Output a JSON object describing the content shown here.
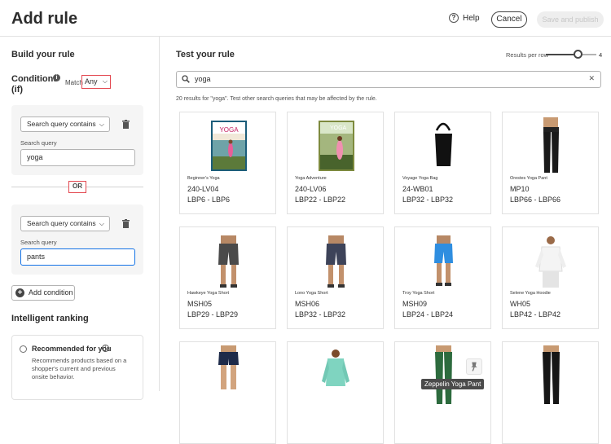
{
  "header": {
    "title": "Add rule",
    "help_label": "Help",
    "cancel_label": "Cancel",
    "save_label": "Save and publish"
  },
  "left": {
    "heading": "Build your rule",
    "conditions_label": "Conditions (if)",
    "match_label": "Match",
    "match_value": "Any",
    "conditions": [
      {
        "type": "Search query contains",
        "field_label": "Search query",
        "value": "yoga"
      },
      {
        "type": "Search query contains",
        "field_label": "Search query",
        "value": "pants"
      }
    ],
    "or_label": "OR",
    "add_condition_label": "Add condition",
    "ranking_heading": "Intelligent ranking",
    "recommended": {
      "title": "Recommended for you",
      "description": "Recommends products based on a shopper's current and previous onsite behavior."
    }
  },
  "right": {
    "heading": "Test your rule",
    "results_per_row_label": "Results per row",
    "results_per_row_value": "4",
    "slider_fraction": 0.55,
    "search_value": "yoga",
    "results_text": "20 results for \"yoga\". Test other search queries that may be affected by the rule.",
    "tooltip": "Zeppelin Yoga Pant",
    "products": [
      {
        "name": "Beginner's Yoga",
        "sku": "240-LV04",
        "price": "LBP6 - LBP6",
        "kind": "dvd-beginner"
      },
      {
        "name": "Yoga Adventure",
        "sku": "240-LV06",
        "price": "LBP22 - LBP22",
        "kind": "dvd-adventure"
      },
      {
        "name": "Voyage Yoga Bag",
        "sku": "24-WB01",
        "price": "LBP32 - LBP32",
        "kind": "bag"
      },
      {
        "name": "Orestes Yoga Pant",
        "sku": "MP10",
        "price": "LBP66 - LBP66",
        "kind": "pant-black"
      },
      {
        "name": "Hawkeye Yoga Short",
        "sku": "MSH05",
        "price": "LBP29 - LBP29",
        "kind": "short-gray"
      },
      {
        "name": "Lono Yoga Short",
        "sku": "MSH06",
        "price": "LBP32 - LBP32",
        "kind": "short-navy"
      },
      {
        "name": "Troy Yoga Short",
        "sku": "MSH09",
        "price": "LBP24 - LBP24",
        "kind": "short-blue"
      },
      {
        "name": "Selene Yoga Hoodie",
        "sku": "WH05",
        "price": "LBP42 - LBP42",
        "kind": "hoodie-white"
      },
      {
        "name": "",
        "sku": "",
        "price": "",
        "kind": "short-women"
      },
      {
        "name": "",
        "sku": "",
        "price": "",
        "kind": "top-teal"
      },
      {
        "name": "",
        "sku": "",
        "price": "",
        "kind": "pant-green"
      },
      {
        "name": "",
        "sku": "",
        "price": "",
        "kind": "pant-black2"
      }
    ]
  }
}
